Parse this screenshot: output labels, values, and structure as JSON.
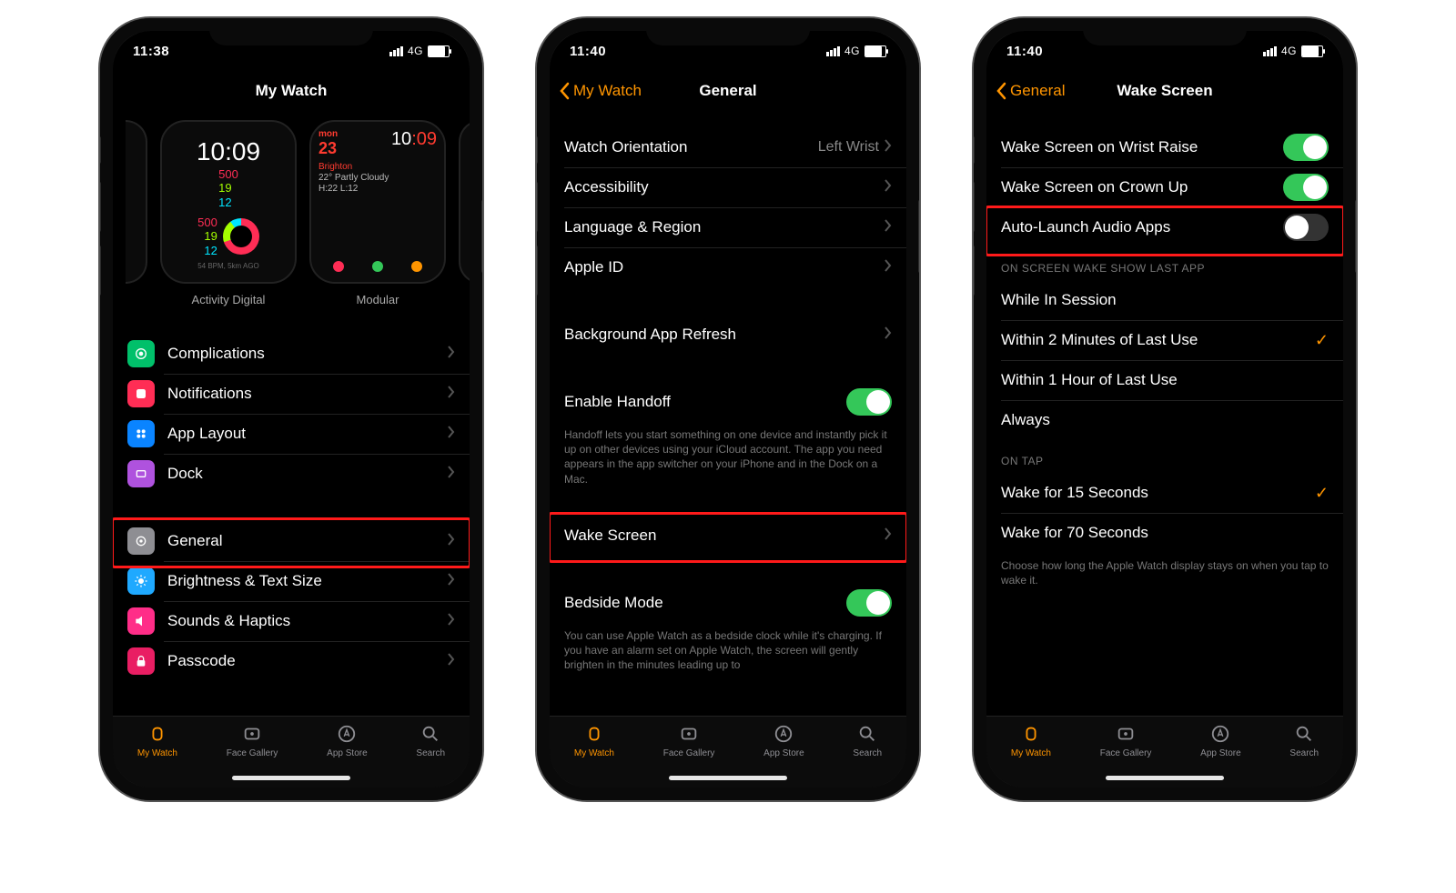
{
  "status": {
    "time1": "11:38",
    "time2": "11:40",
    "time3": "11:40",
    "carrier": "4G"
  },
  "phone1": {
    "title": "My Watch",
    "faces": [
      {
        "name": "Activity Digital",
        "time": "10:09",
        "a": "500",
        "b": "19",
        "c": "12",
        "sub": "54 BPM, 5km AGO"
      },
      {
        "name": "Modular",
        "day": "23",
        "wk": "mon",
        "time": "10:09",
        "city": "Brighton",
        "weather": "22° Partly Cloudy",
        "hl": "H:22 L:12"
      }
    ],
    "items": [
      {
        "k": "complications",
        "label": "Complications",
        "cls": "ic-green"
      },
      {
        "k": "notifications",
        "label": "Notifications",
        "cls": "ic-red"
      },
      {
        "k": "applayout",
        "label": "App Layout",
        "cls": "ic-blue"
      },
      {
        "k": "dock",
        "label": "Dock",
        "cls": "ic-purple"
      }
    ],
    "items2": [
      {
        "k": "general",
        "label": "General",
        "cls": "ic-gray",
        "hl": true
      },
      {
        "k": "brightness",
        "label": "Brightness & Text Size",
        "cls": "ic-cyan"
      },
      {
        "k": "sounds",
        "label": "Sounds & Haptics",
        "cls": "ic-pink"
      },
      {
        "k": "passcode",
        "label": "Passcode",
        "cls": "ic-rose"
      }
    ]
  },
  "phone2": {
    "back": "My Watch",
    "title": "General",
    "g1": [
      {
        "k": "orientation",
        "label": "Watch Orientation",
        "value": "Left Wrist"
      },
      {
        "k": "accessibility",
        "label": "Accessibility"
      },
      {
        "k": "language",
        "label": "Language & Region"
      },
      {
        "k": "appleid",
        "label": "Apple ID"
      }
    ],
    "g2": [
      {
        "k": "bgrefresh",
        "label": "Background App Refresh"
      }
    ],
    "handoff": {
      "label": "Enable Handoff",
      "on": true,
      "foot": "Handoff lets you start something on one device and instantly pick it up on other devices using your iCloud account. The app you need appears in the app switcher on your iPhone and in the Dock on a Mac."
    },
    "wake": {
      "label": "Wake Screen",
      "hl": true
    },
    "bedside": {
      "label": "Bedside Mode",
      "on": true,
      "foot": "You can use Apple Watch as a bedside clock while it's charging. If you have an alarm set on Apple Watch, the screen will gently brighten in the minutes leading up to"
    }
  },
  "phone3": {
    "back": "General",
    "title": "Wake Screen",
    "toggles": [
      {
        "k": "wrist",
        "label": "Wake Screen on Wrist Raise",
        "on": true
      },
      {
        "k": "crown",
        "label": "Wake Screen on Crown Up",
        "on": true
      },
      {
        "k": "audio",
        "label": "Auto-Launch Audio Apps",
        "on": false,
        "hl": true
      }
    ],
    "lastapp": {
      "header": "ON SCREEN WAKE SHOW LAST APP",
      "opts": [
        {
          "k": "session",
          "label": "While In Session"
        },
        {
          "k": "2min",
          "label": "Within 2 Minutes of Last Use",
          "checked": true
        },
        {
          "k": "1hr",
          "label": "Within 1 Hour of Last Use"
        },
        {
          "k": "always",
          "label": "Always"
        }
      ]
    },
    "ontap": {
      "header": "ON TAP",
      "opts": [
        {
          "k": "15s",
          "label": "Wake for 15 Seconds",
          "checked": true
        },
        {
          "k": "70s",
          "label": "Wake for 70 Seconds"
        }
      ],
      "foot": "Choose how long the Apple Watch display stays on when you tap to wake it."
    }
  },
  "tabs": [
    {
      "k": "mywatch",
      "label": "My Watch",
      "active": true
    },
    {
      "k": "facegallery",
      "label": "Face Gallery"
    },
    {
      "k": "appstore",
      "label": "App Store"
    },
    {
      "k": "search",
      "label": "Search"
    }
  ]
}
